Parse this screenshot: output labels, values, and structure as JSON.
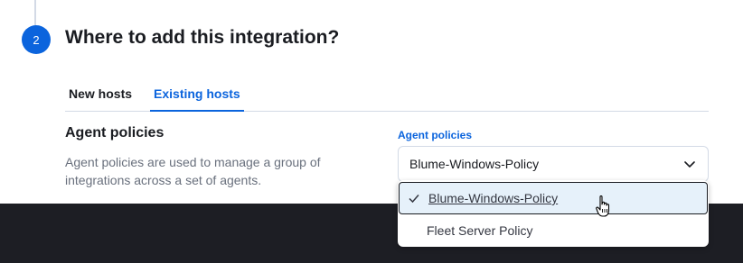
{
  "step": {
    "number": "2",
    "title": "Where to add this integration?"
  },
  "tabs": [
    {
      "label": "New hosts",
      "selected": false
    },
    {
      "label": "Existing hosts",
      "selected": true
    }
  ],
  "agent_policies": {
    "heading": "Agent policies",
    "description": "Agent policies are used to manage a group of integrations across a set of agents.",
    "field_label": "Agent policies",
    "selected_value": "Blume-Windows-Policy",
    "options": [
      {
        "label": "Blume-Windows-Policy",
        "checked": true
      },
      {
        "label": "Fleet Server Policy",
        "checked": false
      }
    ]
  },
  "colors": {
    "accent": "#0b64dd",
    "dark_band": "#1d1e24"
  },
  "icons": {
    "select_caret": "chevron-down-icon",
    "selected_option": "checkmark-icon",
    "pointer": "hand-cursor-icon"
  }
}
